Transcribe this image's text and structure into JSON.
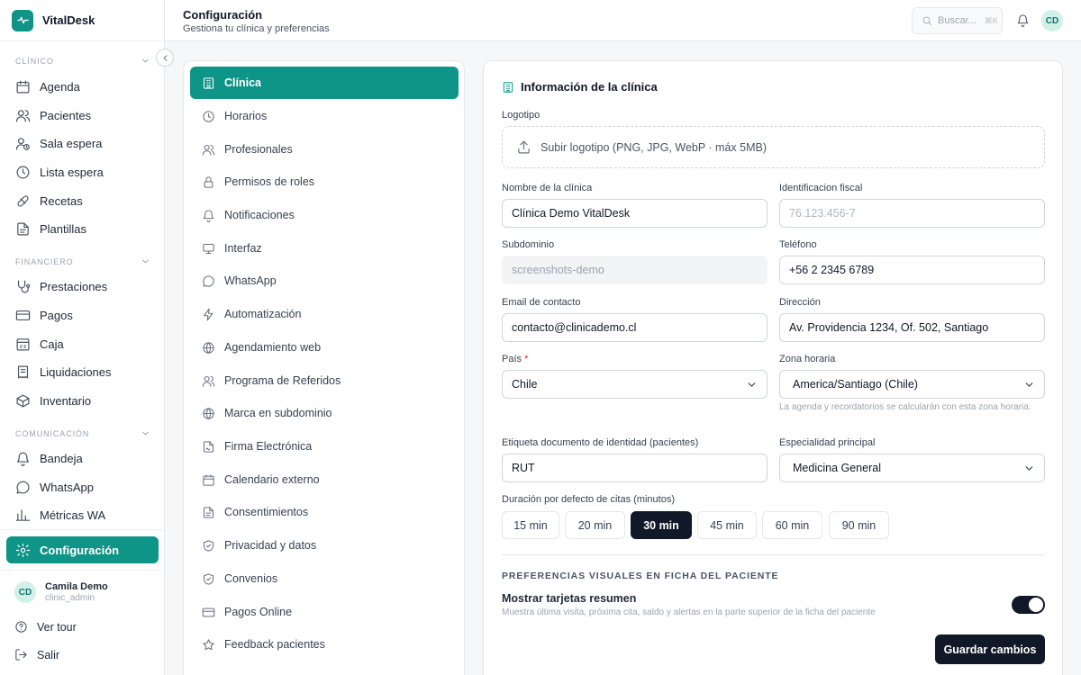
{
  "app": {
    "name": "VitalDesk"
  },
  "sidebar": {
    "sections": [
      {
        "title": "CLÍNICO",
        "items": [
          "Agenda",
          "Pacientes",
          "Sala espera",
          "Lista espera",
          "Recetas",
          "Plantillas"
        ]
      },
      {
        "title": "FINANCIERO",
        "items": [
          "Prestaciones",
          "Pagos",
          "Caja",
          "Liquidaciones",
          "Inventario"
        ]
      },
      {
        "title": "COMUNICACIÓN",
        "items": [
          "Bandeja",
          "WhatsApp",
          "Métricas WA"
        ]
      }
    ],
    "active_item": "Configuración",
    "user": {
      "initials": "CD",
      "name": "Camila Demo",
      "role": "clinic_admin"
    },
    "footer": {
      "tour": "Ver tour",
      "logout": "Salir"
    }
  },
  "header": {
    "title": "Configuración",
    "subtitle": "Gestiona tu clínica y preferencias",
    "search_placeholder": "Buscar...",
    "search_shortcut": "⌘K",
    "avatar_initials": "CD"
  },
  "settings_menu": {
    "items": [
      "Clínica",
      "Horarios",
      "Profesionales",
      "Permisos de roles",
      "Notificaciones",
      "Interfaz",
      "WhatsApp",
      "Automatización",
      "Agendamiento web",
      "Programa de Referidos",
      "Marca en subdominio",
      "Firma Electrónica",
      "Calendario externo",
      "Consentimientos",
      "Privacidad y datos",
      "Convenios",
      "Pagos Online",
      "Feedback pacientes"
    ],
    "active": "Clínica"
  },
  "form": {
    "section_title": "Información de la clínica",
    "logo_label": "Logotipo",
    "logo_upload_text": "Subir logotipo (PNG, JPG, WebP · máx 5MB)",
    "clinic_name": {
      "label": "Nombre de la clínica",
      "value": "Clínica Demo VitalDesk"
    },
    "tax_id": {
      "label": "Identificacion fiscal",
      "placeholder": "76.123.456-7"
    },
    "subdomain": {
      "label": "Subdominio",
      "value": "screenshots-demo"
    },
    "phone": {
      "label": "Teléfono",
      "value": "+56 2 2345 6789"
    },
    "email": {
      "label": "Email de contacto",
      "value": "contacto@clinicademo.cl"
    },
    "address": {
      "label": "Dirección",
      "value": "Av. Providencia 1234, Of. 502, Santiago"
    },
    "country": {
      "label": "País",
      "required_mark": "*",
      "value": "Chile"
    },
    "timezone": {
      "label": "Zona horaria",
      "value": "America/Santiago (Chile)",
      "help": "La agenda y recordatorios se calcularán con esta zona horaria."
    },
    "id_label": {
      "label": "Etiqueta documento de identidad (pacientes)",
      "value": "RUT"
    },
    "specialty": {
      "label": "Especialidad principal",
      "value": "Medicina General"
    },
    "duration": {
      "label": "Duración por defecto de citas (minutos)",
      "options": [
        "15 min",
        "20 min",
        "30 min",
        "45 min",
        "60 min",
        "90 min"
      ],
      "selected": "30 min"
    }
  },
  "preferences": {
    "heading": "PREFERENCIAS VISUALES EN FICHA DEL PACIENTE",
    "show_cards": {
      "title": "Mostrar tarjetas resumen",
      "description": "Muestra última visita, próxima cita, saldo y alertas en la parte superior de la ficha del paciente",
      "enabled": true
    }
  },
  "actions": {
    "save": "Guardar cambios"
  },
  "colors": {
    "accent": "#0f9488",
    "dark": "#111827"
  }
}
